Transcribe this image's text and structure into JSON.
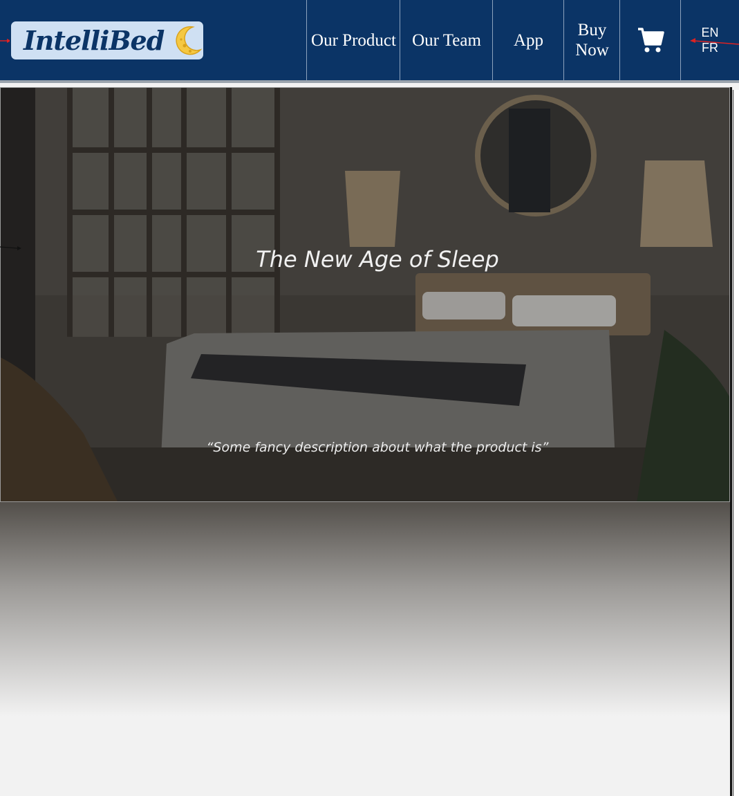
{
  "brand": {
    "name": "IntelliBed",
    "logo_icon": "crescent-moon-icon",
    "color": "#0b3466"
  },
  "nav": {
    "items": [
      {
        "label": "Our Product"
      },
      {
        "label": "Our Team"
      },
      {
        "label": "App"
      },
      {
        "label": "Buy Now"
      }
    ],
    "cart_icon": "shopping-cart-icon",
    "lang_options": [
      "EN",
      "FR"
    ]
  },
  "hero": {
    "title": "The New Age of Sleep",
    "description": "“Some fancy description about what the product is”",
    "background": "bedroom-photo"
  },
  "colors": {
    "navbar": "#0b3466",
    "logo_bg": "#cfe0f3",
    "page_bg": "#f2f2f2"
  }
}
